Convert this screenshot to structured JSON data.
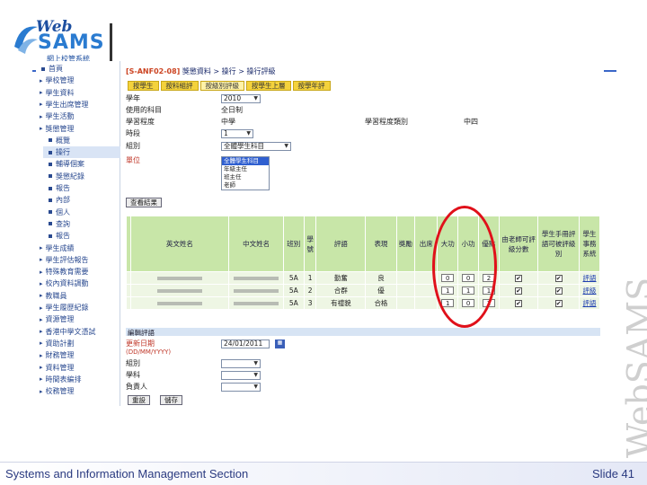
{
  "logo": {
    "web": "Web",
    "sams": "SAMS",
    "subtitle": "網上校管系統"
  },
  "watermark": "WebSAMS",
  "footer": {
    "left": "Systems and Information Management Section",
    "right": "Slide 41"
  },
  "nav": {
    "items": [
      {
        "label": "首頁",
        "type": "bullet",
        "sel": false
      },
      {
        "label": "學校管理",
        "type": "arrow",
        "sel": false
      },
      {
        "label": "學生資料",
        "type": "arrow",
        "sel": false
      },
      {
        "label": "學生出席管理",
        "type": "arrow",
        "sel": false
      },
      {
        "label": "學生活動",
        "type": "arrow",
        "sel": false
      },
      {
        "label": "獎懲管理",
        "type": "arrow",
        "sel": false
      },
      {
        "label": "概覽",
        "type": "sub",
        "sel": false
      },
      {
        "label": "操行",
        "type": "sub",
        "sel": true
      },
      {
        "label": "輔導個案",
        "type": "sub",
        "sel": false
      },
      {
        "label": "獎懲紀錄",
        "type": "sub",
        "sel": false
      },
      {
        "label": "報告",
        "type": "sub",
        "sel": false
      },
      {
        "label": "內部",
        "type": "sub",
        "sel": false
      },
      {
        "label": "個人",
        "type": "sub",
        "sel": false
      },
      {
        "label": "查詢",
        "type": "sub",
        "sel": false
      },
      {
        "label": "報告",
        "type": "sub",
        "sel": false
      },
      {
        "label": "學生成績",
        "type": "arrow",
        "sel": false
      },
      {
        "label": "學生評估報告",
        "type": "arrow",
        "sel": false
      },
      {
        "label": "特殊教育需要",
        "type": "arrow",
        "sel": false
      },
      {
        "label": "校內資料調動",
        "type": "arrow",
        "sel": false
      },
      {
        "label": "教職員",
        "type": "arrow",
        "sel": false
      },
      {
        "label": "學生履歷紀錄",
        "type": "arrow",
        "sel": false
      },
      {
        "label": "資源管理",
        "type": "arrow",
        "sel": false
      },
      {
        "label": "香港中學文憑試",
        "type": "arrow",
        "sel": false
      },
      {
        "label": "資助計劃",
        "type": "arrow",
        "sel": false
      },
      {
        "label": "財務管理",
        "type": "arrow",
        "sel": false
      },
      {
        "label": "資料管理",
        "type": "arrow",
        "sel": false
      },
      {
        "label": "時間表編排",
        "type": "arrow",
        "sel": false
      },
      {
        "label": "校務管理",
        "type": "arrow",
        "sel": false
      }
    ]
  },
  "main": {
    "crumb_code": "[S-ANF02-08]",
    "crumb_path": "獎懲資料 > 操行 > 操行評級",
    "tabs": [
      {
        "label": "按學生",
        "active": false
      },
      {
        "label": "按科組評",
        "active": false
      },
      {
        "label": "按級別評級",
        "active": true
      },
      {
        "label": "按學生上層",
        "active": false
      },
      {
        "label": "按學年評",
        "active": false
      }
    ],
    "form": {
      "year_label": "學年",
      "year_value": "2010",
      "school_label": "使用的科目",
      "school_value": "全日制",
      "level_label": "學習程度",
      "level_value": "中學",
      "level_right_label": "學習程度類別",
      "level_right_value": "中四",
      "term_label": "時段",
      "term_value": "1",
      "group_label": "組別",
      "group_value": "全體學生科目",
      "unit_label": "單位",
      "list_options": [
        "全體學生科目",
        "年級主任",
        "班主任",
        "老師"
      ],
      "view_button": "查看結果"
    },
    "table": {
      "headers": [
        "",
        "英文姓名",
        "中文姓名",
        "班別",
        "學號",
        "評語",
        "表現",
        "獎勵",
        "出席",
        "大功",
        "小功",
        "優點",
        "由老師可評級分數",
        "學生手冊評語可被評級別",
        "學生事務系統"
      ],
      "rows": [
        {
          "class": "5A",
          "no": "1",
          "cmt": "勤奮",
          "grade": "良",
          "a": "0",
          "b": "0",
          "c": "2",
          "link": "評語"
        },
        {
          "class": "5A",
          "no": "2",
          "cmt": "合群",
          "grade": "優",
          "a": "1",
          "b": "1",
          "c": "1",
          "link": "評級"
        },
        {
          "class": "5A",
          "no": "3",
          "cmt": "有禮貌",
          "grade": "合格",
          "a": "1",
          "b": "0",
          "c": "1",
          "link": "評語"
        }
      ]
    },
    "edit": {
      "header": "編輯評語",
      "date_label": "更新日期",
      "date_format": "(DD/MM/YYYY)",
      "date_value": "24/01/2011",
      "f1_label": "組別",
      "f2_label": "學科",
      "f3_label": "負責人",
      "save": "儲存",
      "cancel": "重設"
    }
  }
}
